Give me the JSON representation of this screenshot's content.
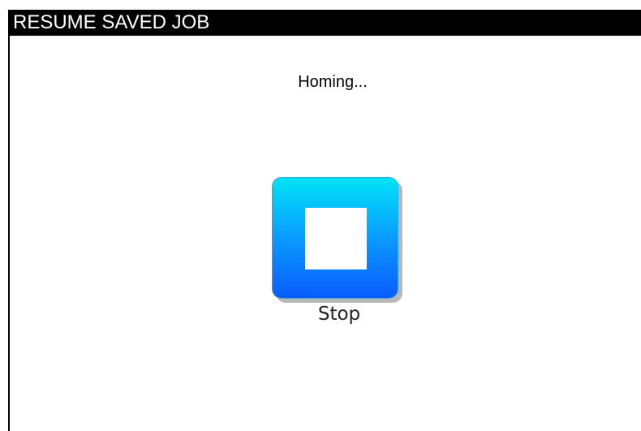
{
  "window": {
    "title": "RESUME SAVED JOB"
  },
  "status": {
    "message": "Homing..."
  },
  "stop_button": {
    "label": "Stop",
    "icon": "stop-square-icon",
    "colors": {
      "gradient_top": "#00e4f6",
      "gradient_bottom": "#0a5cff",
      "symbol": "#ffffff"
    }
  }
}
